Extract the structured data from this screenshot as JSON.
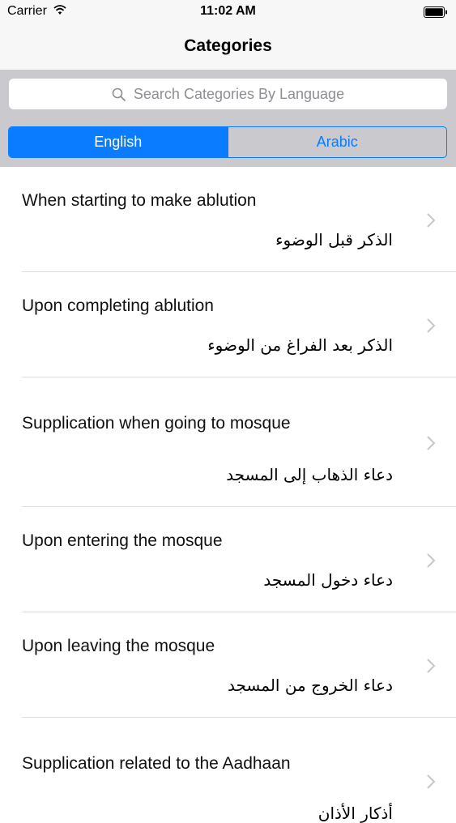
{
  "status": {
    "carrier": "Carrier",
    "time": "11:02 AM"
  },
  "nav": {
    "title": "Categories"
  },
  "search": {
    "placeholder": "Search Categories By Language"
  },
  "segments": {
    "english": "English",
    "arabic": "Arabic",
    "selected": "English"
  },
  "colors": {
    "accent": "#0a7cff",
    "search_bg": "#c9c9ce",
    "separator": "#dcdce0"
  },
  "categories": [
    {
      "english": "When starting to make ablution",
      "arabic": "الذكر قبل الوضوء"
    },
    {
      "english": "Upon completing ablution",
      "arabic": "الذكر بعد الفراغ من الوضوء"
    },
    {
      "english": "Supplication when going to mosque",
      "arabic": "دعاء الذهاب إلى المسجد"
    },
    {
      "english": "Upon entering the mosque",
      "arabic": "دعاء دخول المسجد"
    },
    {
      "english": "Upon leaving the mosque",
      "arabic": "دعاء الخروج من المسجد"
    },
    {
      "english": "Supplication related to the Aadhaan",
      "arabic": "أذكار الأذان"
    }
  ]
}
